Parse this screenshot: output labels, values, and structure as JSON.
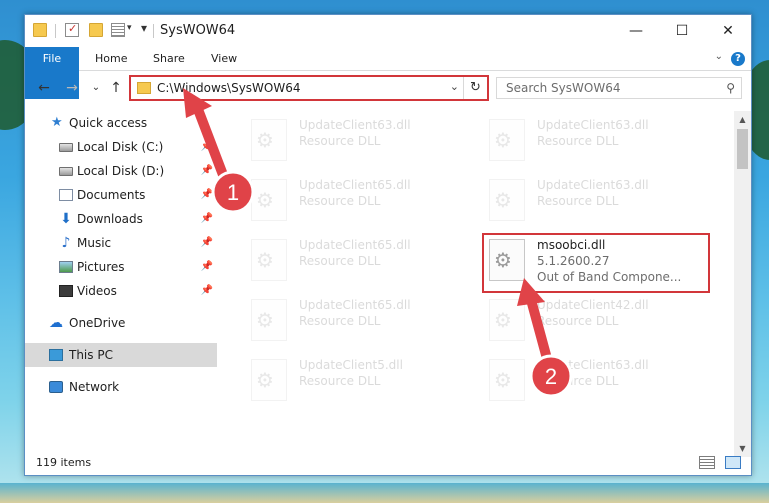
{
  "window": {
    "title": "SysWOW64",
    "controls": {
      "minimize": "—",
      "maximize": "☐",
      "close": "✕"
    }
  },
  "ribbon": {
    "tabs": [
      "File",
      "Home",
      "Share",
      "View"
    ],
    "help": "?"
  },
  "nav": {
    "address": "C:\\Windows\\SysWOW64",
    "search_placeholder": "Search SysWOW64"
  },
  "sidebar": {
    "items": [
      {
        "label": "Quick access",
        "icon": "star-icon"
      },
      {
        "label": "Local Disk (C:)",
        "icon": "drive-icon",
        "pinned": true
      },
      {
        "label": "Local Disk (D:)",
        "icon": "drive-icon",
        "pinned": true
      },
      {
        "label": "Documents",
        "icon": "documents-icon",
        "pinned": true
      },
      {
        "label": "Downloads",
        "icon": "downloads-icon",
        "pinned": true
      },
      {
        "label": "Music",
        "icon": "music-icon",
        "pinned": true
      },
      {
        "label": "Pictures",
        "icon": "pictures-icon",
        "pinned": true
      },
      {
        "label": "Videos",
        "icon": "videos-icon",
        "pinned": true
      },
      {
        "label": "OneDrive",
        "icon": "onedrive-icon"
      },
      {
        "label": "This PC",
        "icon": "this-pc-icon",
        "selected": true
      },
      {
        "label": "Network",
        "icon": "network-icon"
      }
    ]
  },
  "files": [
    {
      "name": "UpdateClient63.dll",
      "type": "Resource DLL",
      "faded": true
    },
    {
      "name": "UpdateClient63.dll",
      "type": "Resource DLL",
      "faded": true
    },
    {
      "name": "UpdateClient65.dll",
      "type": "Resource DLL",
      "faded": true
    },
    {
      "name": "UpdateClient63.dll",
      "type": "Resource DLL",
      "faded": true
    },
    {
      "name": "UpdateClient65.dll",
      "type": "Resource DLL",
      "faded": true
    },
    {
      "name": "msoobci.dll",
      "version": "5.1.2600.27",
      "type": "Out of Band Compone...",
      "faded": false
    },
    {
      "name": "UpdateClient65.dll",
      "type": "Resource DLL",
      "faded": true
    },
    {
      "name": "UpdateClient42.dll",
      "type": "Resource DLL",
      "faded": true
    },
    {
      "name": "UpdateClient5.dll",
      "type": "Resource DLL",
      "faded": true
    },
    {
      "name": "UpdateClient63.dll",
      "type": "Resource DLL",
      "faded": true
    }
  ],
  "status": {
    "item_count": "119 items"
  },
  "annotations": {
    "step1": "1",
    "step2": "2",
    "color": "#e04348"
  },
  "colors": {
    "accent": "#1979ca",
    "highlight": "#d2363a"
  }
}
